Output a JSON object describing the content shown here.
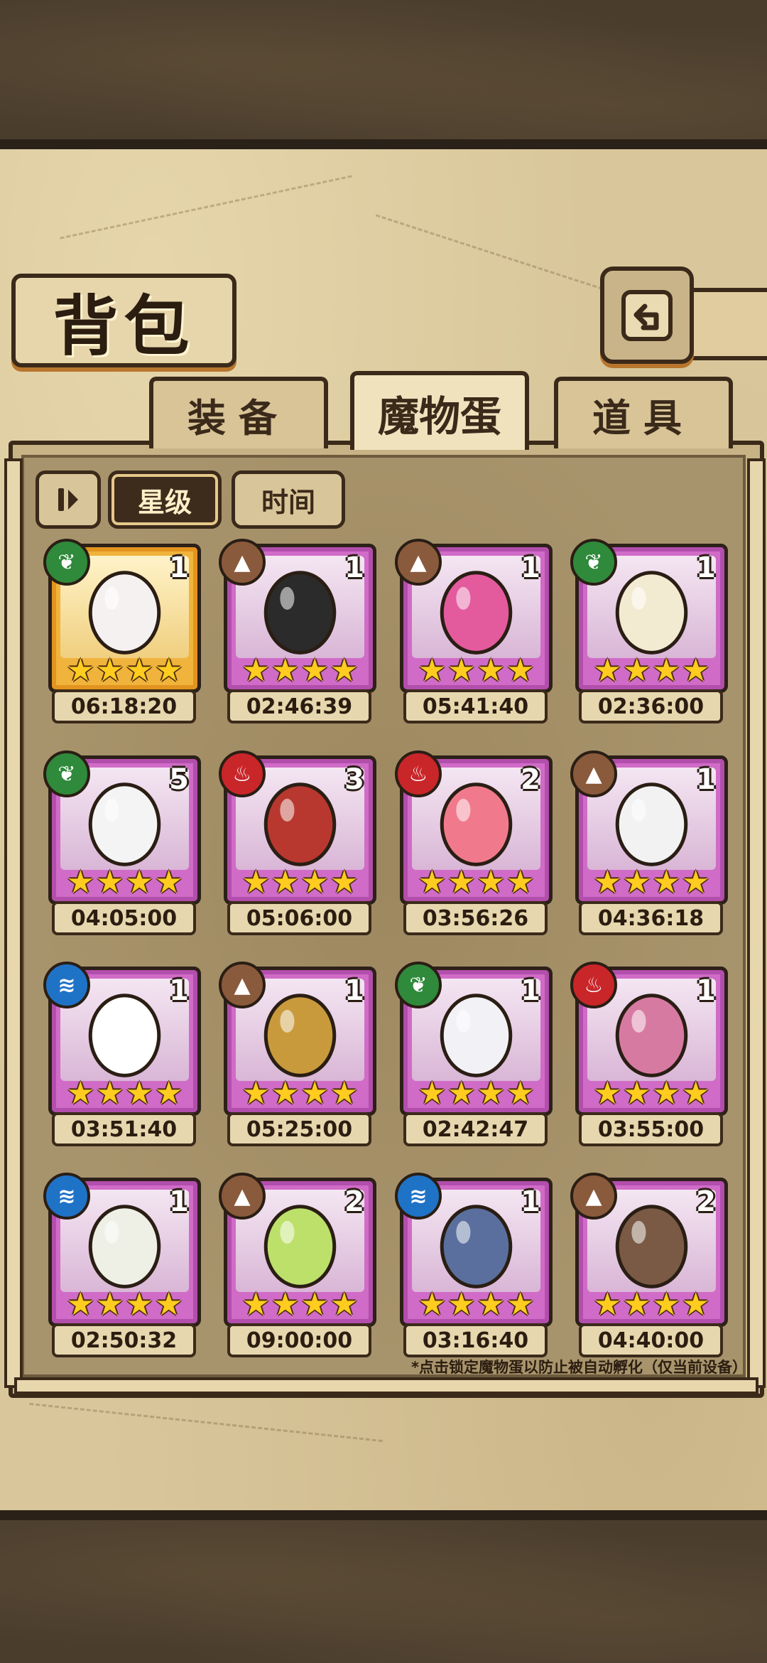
{
  "title": "背包",
  "tabs": [
    {
      "label": "装备",
      "active": false
    },
    {
      "label": "魔物蛋",
      "active": true
    },
    {
      "label": "道具",
      "active": false
    }
  ],
  "sort": {
    "star_label": "星级",
    "time_label": "时间",
    "active": "star"
  },
  "eggs": [
    {
      "count": "1",
      "element": "nature-icon",
      "stars": 4,
      "frame": "gold",
      "art": "lamp-icon",
      "time": "06:18:20"
    },
    {
      "count": "1",
      "element": "earth-icon",
      "stars": 4,
      "frame": "purple",
      "art": "spider-egg-icon",
      "time": "02:46:39"
    },
    {
      "count": "1",
      "element": "earth-icon",
      "stars": 4,
      "frame": "purple",
      "art": "thorn-egg-icon",
      "time": "05:41:40"
    },
    {
      "count": "1",
      "element": "nature-icon",
      "stars": 4,
      "frame": "purple",
      "art": "winged-egg-icon",
      "time": "02:36:00"
    },
    {
      "count": "5",
      "element": "nature-icon",
      "stars": 4,
      "frame": "purple",
      "art": "battleship-egg-icon",
      "time": "04:05:00"
    },
    {
      "count": "3",
      "element": "fire-icon",
      "stars": 4,
      "frame": "purple",
      "art": "wrapped-egg-icon",
      "time": "05:06:00"
    },
    {
      "count": "2",
      "element": "fire-icon",
      "stars": 4,
      "frame": "purple",
      "art": "kimono-egg-icon",
      "time": "03:56:26"
    },
    {
      "count": "1",
      "element": "earth-icon",
      "stars": 4,
      "frame": "purple",
      "art": "panda-egg-icon",
      "time": "04:36:18"
    },
    {
      "count": "1",
      "element": "water-icon",
      "stars": 4,
      "frame": "purple",
      "art": "gunner-egg-icon",
      "time": "03:51:40"
    },
    {
      "count": "1",
      "element": "earth-icon",
      "stars": 4,
      "frame": "purple",
      "art": "fur-egg-icon",
      "time": "05:25:00"
    },
    {
      "count": "1",
      "element": "nature-icon",
      "stars": 4,
      "frame": "purple",
      "art": "feather-egg-icon",
      "time": "02:42:47"
    },
    {
      "count": "1",
      "element": "fire-icon",
      "stars": 4,
      "frame": "purple",
      "art": "demon-egg-icon",
      "time": "03:55:00"
    },
    {
      "count": "1",
      "element": "water-icon",
      "stars": 4,
      "frame": "purple",
      "art": "leaf-egg-icon",
      "time": "02:50:32"
    },
    {
      "count": "2",
      "element": "earth-icon",
      "stars": 4,
      "frame": "purple",
      "art": "cracked-egg-icon",
      "time": "09:00:00"
    },
    {
      "count": "1",
      "element": "water-icon",
      "stars": 4,
      "frame": "purple",
      "art": "ship-egg-icon",
      "time": "03:16:40"
    },
    {
      "count": "2",
      "element": "earth-icon",
      "stars": 4,
      "frame": "purple",
      "art": "critter-egg-icon",
      "time": "04:40:00"
    }
  ],
  "footnote": "*点击锁定魔物蛋以防止被自动孵化（仅当前设备）"
}
